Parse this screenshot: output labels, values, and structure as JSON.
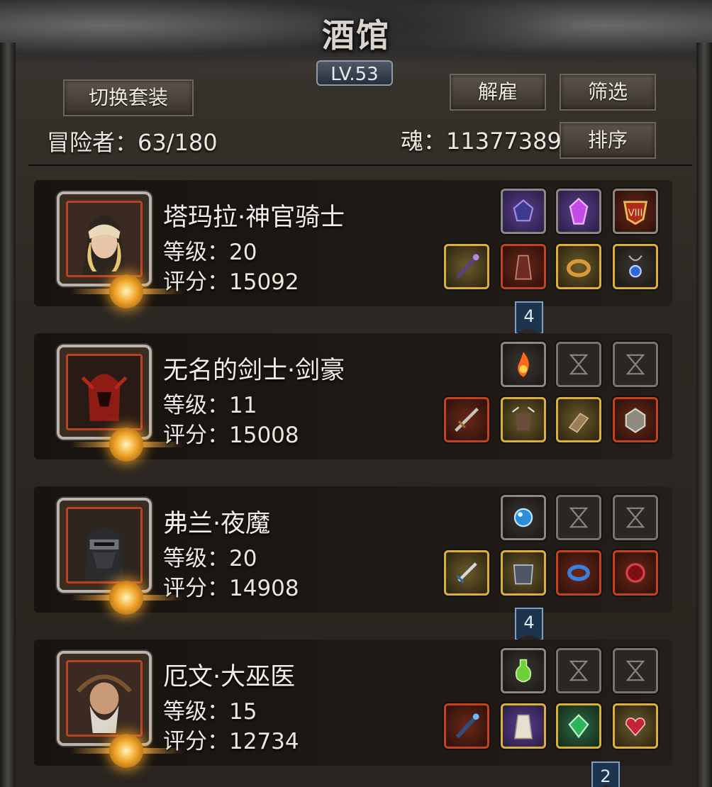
{
  "header": {
    "title": "酒馆",
    "level_badge": "LV.53",
    "switch_set_label": "切换套装",
    "dismiss_label": "解雇",
    "filter_label": "筛选",
    "sort_label": "排序",
    "adventurers": "冒险者：63/180",
    "soul": "魂：11377389"
  },
  "heroes": [
    {
      "name": "塔玛拉·神官骑士",
      "level": "等级：20",
      "score": "评分：15092",
      "ribbon": "4",
      "top_slots": [
        "purple-gem-icon",
        "violet-crystal-icon",
        "crest-badge-icon"
      ],
      "bottom_slots": [
        "staff-icon",
        "red-robe-icon",
        "gold-ring-icon",
        "blue-amulet-icon"
      ]
    },
    {
      "name": "无名的剑士·剑豪",
      "level": "等级：11",
      "score": "评分：15008",
      "ribbon": "",
      "top_slots": [
        "fire-rune-icon",
        "empty-slot-icon",
        "empty-slot-icon"
      ],
      "bottom_slots": [
        "greatsword-icon",
        "spiked-armor-icon",
        "gauntlet-icon",
        "ring-stone-icon"
      ]
    },
    {
      "name": "弗兰·夜魔",
      "level": "等级：20",
      "score": "评分：14908",
      "ribbon": "4",
      "top_slots": [
        "blue-orb-icon",
        "empty-slot-icon",
        "empty-slot-icon"
      ],
      "bottom_slots": [
        "dagger-icon",
        "plate-armor-icon",
        "blue-bracelet-icon",
        "red-ring-icon"
      ]
    },
    {
      "name": "厄文·大巫医",
      "level": "等级：15",
      "score": "评分：12734",
      "ribbon": "2",
      "top_slots": [
        "green-potion-icon",
        "empty-slot-icon",
        "empty-slot-icon"
      ],
      "bottom_slots": [
        "blue-staff-icon",
        "white-robe-icon",
        "green-gem-icon",
        "heart-pendant-icon"
      ]
    }
  ]
}
